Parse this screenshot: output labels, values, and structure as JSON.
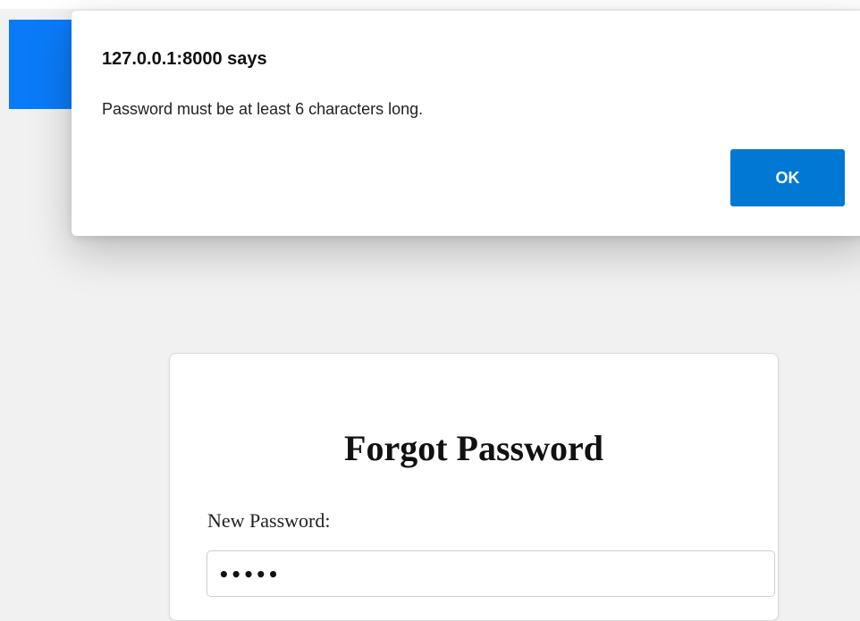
{
  "dialog": {
    "title": "127.0.0.1:8000 says",
    "message": "Password must be at least 6 characters long.",
    "ok_label": "OK",
    "button_color": "#0078d4"
  },
  "page": {
    "header_color": "#0a7bf8",
    "background_color": "#f1f1f1"
  },
  "form": {
    "title": "Forgot Password",
    "new_password_label": "New Password:",
    "new_password_value": "•••••"
  }
}
